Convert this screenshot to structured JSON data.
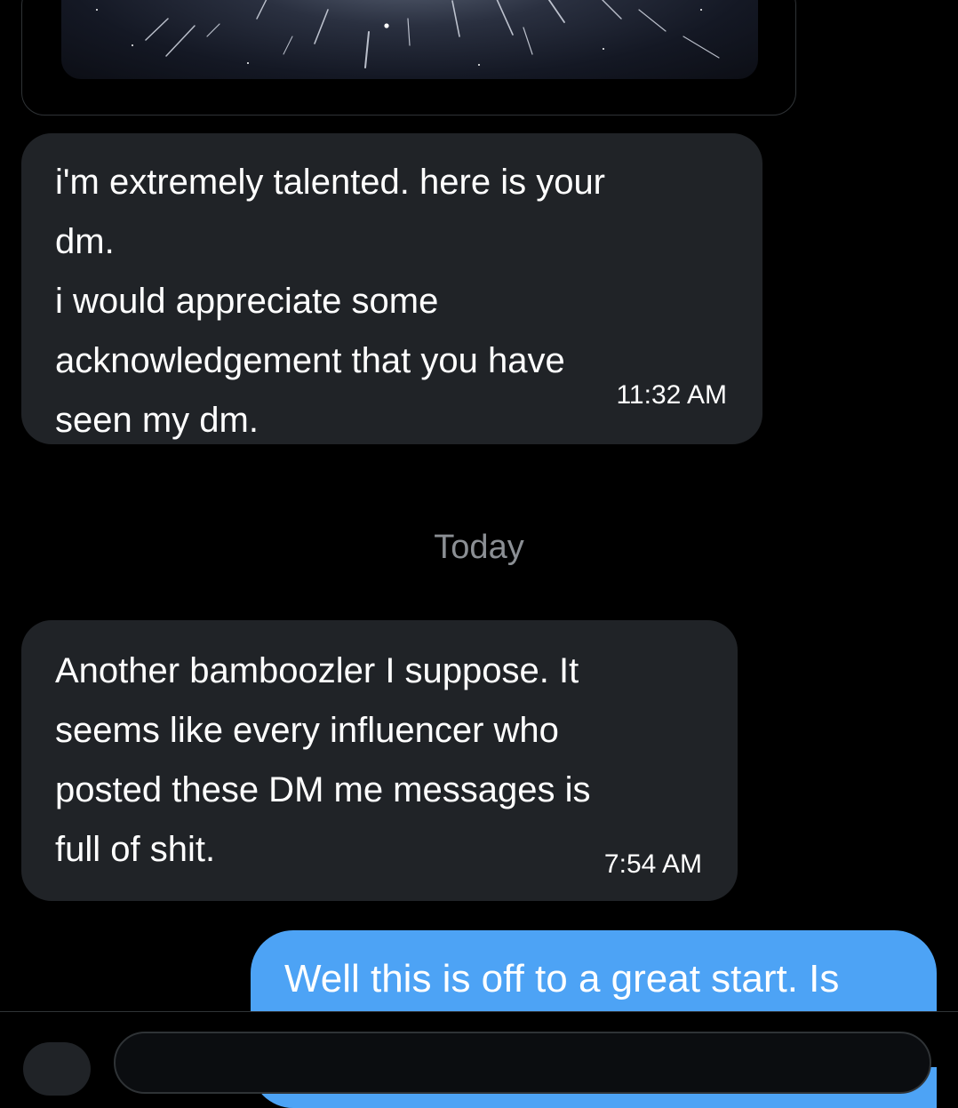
{
  "conversation": {
    "media_message": {
      "image_alt": "starfield light streaks image"
    },
    "messages": [
      {
        "lines": [
          "i'm extremely talented. here is your",
          "dm.",
          "i would appreciate some",
          "acknowledgement that you have",
          "seen my dm."
        ],
        "text": "i'm extremely talented. here is your\ndm.\ni would appreciate some\nacknowledgement that you have\nseen my dm.",
        "time": "11:32 AM",
        "direction": "received"
      },
      {
        "text": "Another bamboozler I suppose. It\nseems like every influencer who\nposted these DM me messages is\nfull of shit.",
        "time": "7:54 AM",
        "direction": "received"
      },
      {
        "text": "Well this is off to a great start. Is",
        "direction": "sent"
      }
    ],
    "day_separator": "Today"
  },
  "colors": {
    "background": "#000000",
    "received_bubble": "#202327",
    "sent_bubble": "#4da3f5",
    "separator_text": "#8b8f94"
  },
  "icons": {
    "media_button": "media-icon"
  }
}
